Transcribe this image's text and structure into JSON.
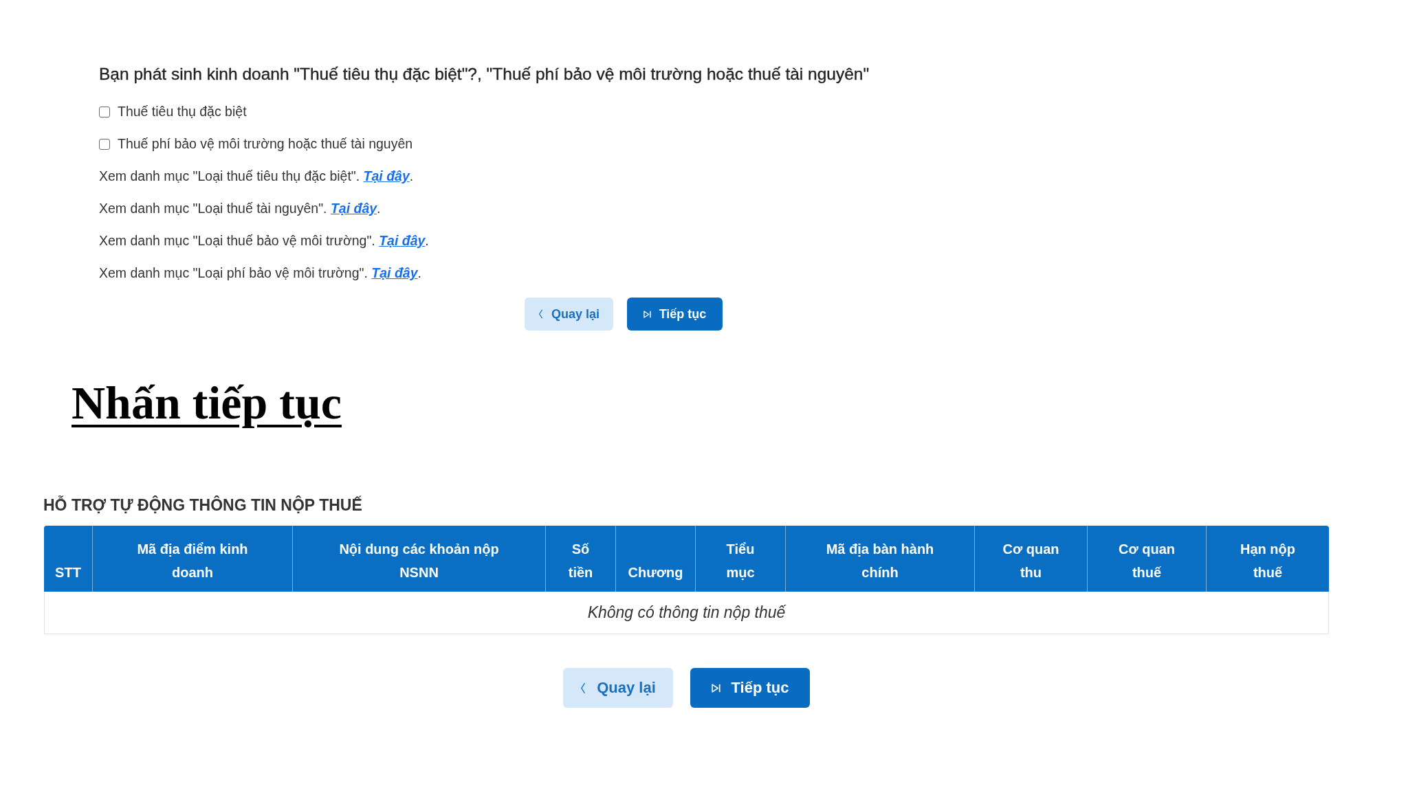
{
  "question": {
    "title": "Bạn phát sinh kinh doanh \"Thuế tiêu thụ đặc biệt\"?, \"Thuế phí bảo vệ môi trường hoặc thuế tài nguyên\"",
    "options": [
      {
        "label": "Thuế tiêu thụ đặc biệt",
        "checked": false
      },
      {
        "label": "Thuế phí bảo vệ môi trường hoặc thuế tài nguyên",
        "checked": false
      }
    ],
    "catalog_notes": [
      {
        "text": "Xem danh mục \"Loại thuế tiêu thụ đặc biệt\".",
        "link": "Tại đây",
        "suffix": "."
      },
      {
        "text": "Xem danh mục \"Loại thuế tài nguyên\".",
        "link": "Tại đây",
        "suffix": "."
      },
      {
        "text": "Xem danh mục \"Loại thuế bảo vệ môi trường\".",
        "link": "Tại đây",
        "suffix": "."
      },
      {
        "text": "Xem danh mục \"Loại phí bảo vệ môi trường\".",
        "link": "Tại đây",
        "suffix": "."
      }
    ],
    "buttons": [
      {
        "kind": "back",
        "label": "Quay lại"
      },
      {
        "kind": "next",
        "label": "Tiếp tục"
      }
    ]
  },
  "instruction": "Nhấn tiếp tục",
  "tax_support": {
    "title": "HỖ TRỢ TỰ ĐỘNG THÔNG TIN NỘP THUẾ",
    "table": {
      "columns": [
        "STT",
        "Mã địa điểm kinh doanh",
        "Nội dung các khoản nộp NSNN",
        "Số tiền",
        "Chương",
        "Tiểu mục",
        "Mã địa bàn hành chính",
        "Cơ quan thu",
        "Cơ quan thuế",
        "Hạn nộp thuế"
      ],
      "empty_message": "Không có thông tin nộp thuế"
    },
    "buttons": [
      {
        "kind": "back",
        "label": "Quay lại"
      },
      {
        "kind": "next",
        "label": "Tiếp tục"
      }
    ]
  }
}
